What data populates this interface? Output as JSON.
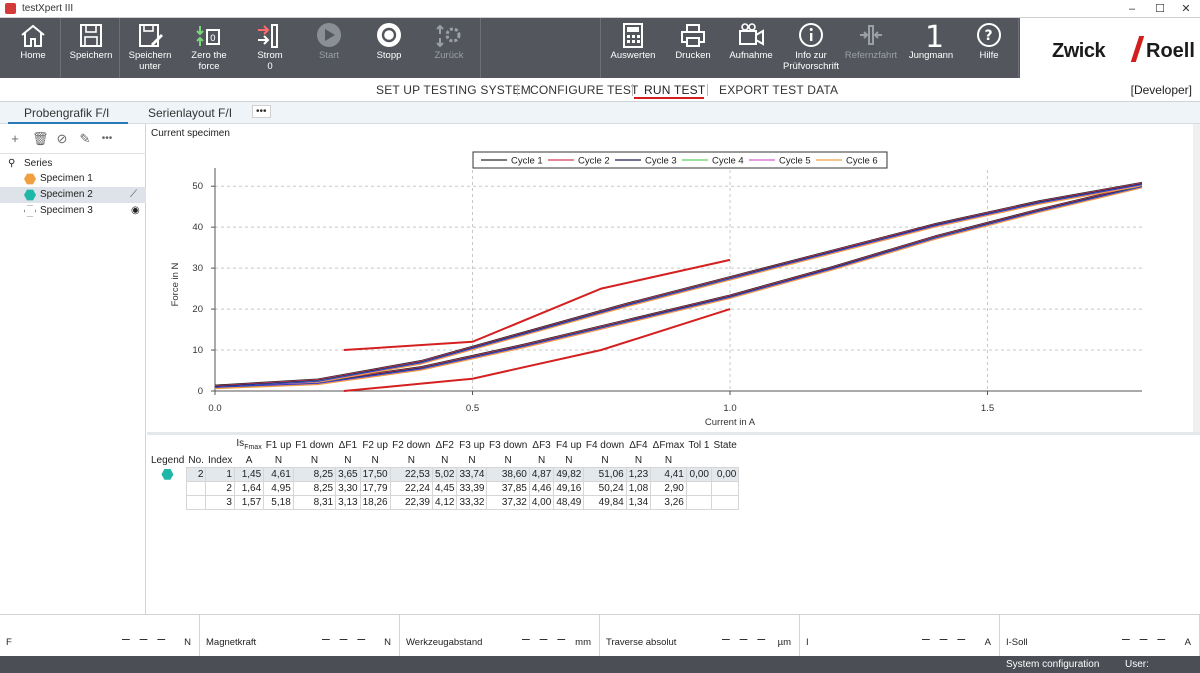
{
  "window": {
    "title": "testXpert III"
  },
  "toolbar": {
    "left": [
      {
        "label": "Home",
        "icon": "home-icon"
      },
      {
        "label": "Speichern",
        "icon": "save-icon"
      },
      {
        "label": "Speichern\nunter",
        "icon": "save-as-icon"
      },
      {
        "label": "Zero the\nforce",
        "icon": "zero-force-icon"
      },
      {
        "label": "Strom\n0",
        "icon": "current-icon"
      },
      {
        "label": "Start",
        "icon": "play-icon",
        "disabled": true
      },
      {
        "label": "Stopp",
        "icon": "stop-icon"
      },
      {
        "label": "Zurück",
        "icon": "return-icon",
        "disabled": true
      }
    ],
    "right": [
      {
        "label": "Auswerten",
        "icon": "calculator-icon"
      },
      {
        "label": "Drucken",
        "icon": "printer-icon"
      },
      {
        "label": "Aufnahme",
        "icon": "camera-icon"
      },
      {
        "label": "Info zur\nPrüfvorschrift",
        "icon": "info-icon"
      },
      {
        "label": "Refernzfahrt",
        "icon": "reference-run-icon",
        "disabled": true
      },
      {
        "label": "Jungmann",
        "icon": "user-number-icon",
        "glyph": "1"
      },
      {
        "label": "Hilfe",
        "icon": "help-icon"
      }
    ],
    "logo": {
      "left": "Zwick",
      "right": "Roell"
    }
  },
  "workflow": {
    "tabs": [
      "SET UP TESTING SYSTEM",
      "CONFIGURE TEST",
      "RUN TEST",
      "EXPORT TEST DATA"
    ],
    "active": "RUN TEST",
    "role": "[Developer]"
  },
  "view_tabs": {
    "tabs": [
      "Probengrafik F/I",
      "Serienlayout F/I"
    ],
    "more": "•••"
  },
  "series_panel": {
    "root": "Series",
    "items": [
      {
        "label": "Specimen 1",
        "color": "#f0a040"
      },
      {
        "label": "Specimen 2",
        "color": "#1fb8a8",
        "selected": true
      },
      {
        "label": "Specimen 3",
        "color": "#ffffff"
      }
    ]
  },
  "chart_panel": {
    "caption": "Current specimen"
  },
  "chart_data": {
    "type": "line",
    "xlabel": "Current in A",
    "ylabel": "Force in N",
    "xlim": [
      0,
      1.8
    ],
    "ylim": [
      0,
      52
    ],
    "xticks": [
      "0.0",
      "0.5",
      "1.0",
      "1.5"
    ],
    "yticks": [
      "0",
      "10",
      "20",
      "30",
      "40",
      "50"
    ],
    "legend": [
      "Cycle 1",
      "Cycle 2",
      "Cycle 3",
      "Cycle 4",
      "Cycle 5",
      "Cycle 6"
    ],
    "legend_colors": [
      "#2a2a2a",
      "#d63a5a",
      "#1a1a50",
      "#5fd060",
      "#d060d0",
      "#f0a040"
    ],
    "curves": {
      "up": {
        "x": [
          0,
          0.2,
          0.4,
          0.6,
          0.8,
          1.0,
          1.2,
          1.4,
          1.6,
          1.8
        ],
        "y": [
          1,
          2.5,
          7,
          14,
          21,
          27.5,
          34,
          40.5,
          46,
          50.5
        ]
      },
      "down": {
        "x": [
          1.8,
          1.6,
          1.4,
          1.2,
          1.0,
          0.8,
          0.6,
          0.4,
          0.2,
          0
        ],
        "y": [
          50,
          44,
          37.5,
          30,
          23,
          17,
          11,
          5.5,
          2,
          1
        ]
      },
      "tol_upper": {
        "x": [
          0.25,
          0.5,
          0.75,
          1.0
        ],
        "y": [
          10,
          12,
          25,
          32
        ]
      },
      "tol_lower": {
        "x": [
          0.25,
          0.5,
          0.75,
          1.0
        ],
        "y": [
          0,
          3,
          10,
          20
        ]
      }
    }
  },
  "results": {
    "headers1": [
      "",
      "",
      "",
      "Is",
      "F1 up",
      "F1 down",
      "ΔF1",
      "F2 up",
      "F2 down",
      "ΔF2",
      "F3 up",
      "F3 down",
      "ΔF3",
      "F4 up",
      "F4 down",
      "ΔF4",
      "ΔFmax",
      "Tol 1",
      "State"
    ],
    "is_sub": "Fmax",
    "headers2": [
      "Legend",
      "No.",
      "Index",
      "A",
      "N",
      "N",
      "N",
      "N",
      "N",
      "N",
      "N",
      "N",
      "N",
      "N",
      "N",
      "N",
      "N",
      "",
      ""
    ],
    "rows": [
      [
        "",
        "2",
        "1",
        "1,45",
        "4,61",
        "8,25",
        "3,65",
        "17,50",
        "22,53",
        "5,02",
        "33,74",
        "38,60",
        "4,87",
        "49,82",
        "51,06",
        "1,23",
        "4,41",
        "0,00",
        "0,00"
      ],
      [
        "",
        "",
        "2",
        "1,64",
        "4,95",
        "8,25",
        "3,30",
        "17,79",
        "22,24",
        "4,45",
        "33,39",
        "37,85",
        "4,46",
        "49,16",
        "50,24",
        "1,08",
        "2,90",
        "",
        ""
      ],
      [
        "",
        "",
        "3",
        "1,57",
        "5,18",
        "8,31",
        "3,13",
        "18,26",
        "22,39",
        "4,12",
        "33,32",
        "37,32",
        "4,00",
        "48,49",
        "49,84",
        "1,34",
        "3,26",
        "",
        ""
      ]
    ]
  },
  "status": [
    {
      "label": "F",
      "value": "– – –",
      "unit": "N"
    },
    {
      "label": "Magnetkraft",
      "value": "– – –",
      "unit": "N"
    },
    {
      "label": "Werkzeugabstand",
      "value": "– – –",
      "unit": "mm"
    },
    {
      "label": "Traverse absolut",
      "value": "– – –",
      "unit": "µm"
    },
    {
      "label": "I",
      "value": "– – –",
      "unit": "A"
    },
    {
      "label": "I-Soll",
      "value": "– – –",
      "unit": "A"
    }
  ],
  "footer": {
    "system": "System configuration",
    "user": "User:"
  }
}
